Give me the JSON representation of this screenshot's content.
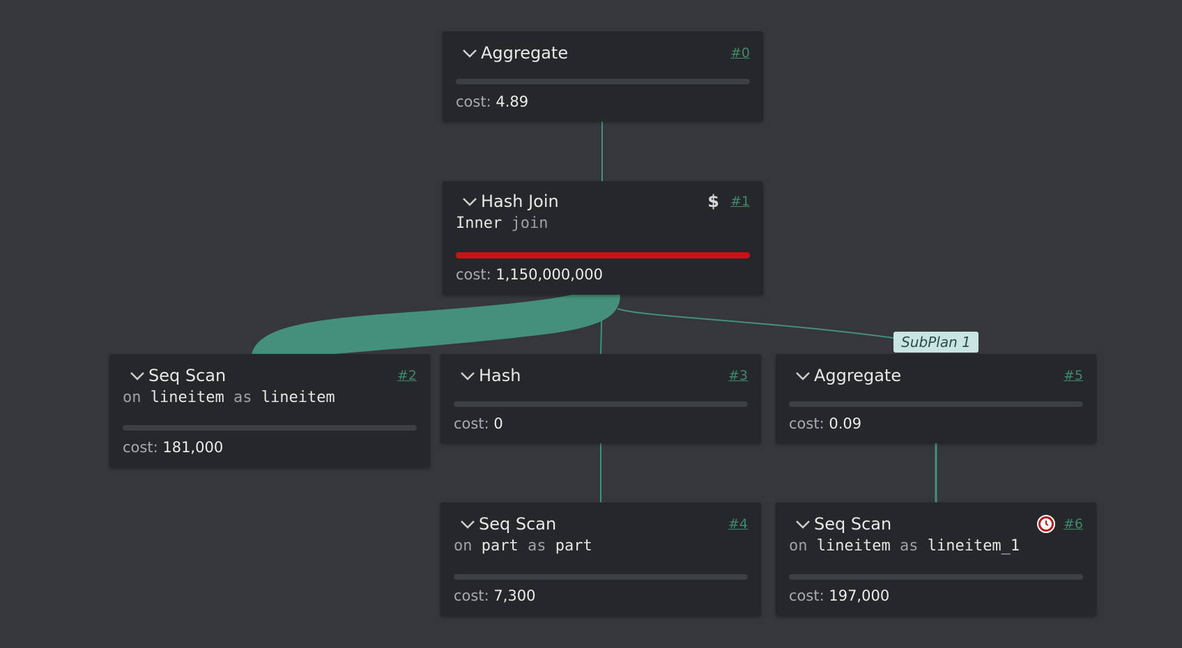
{
  "colors": {
    "edge": "#44907a",
    "cost_bar_high": "#c41414",
    "link": "#3f8a6d"
  },
  "nodes": [
    {
      "id": "#0",
      "title": "Aggregate",
      "cost_label": "cost:",
      "cost_value": "4.89",
      "cost_fraction": 0.0
    },
    {
      "id": "#1",
      "title": "Hash Join",
      "sub_main": "Inner",
      "sub_kw": "join",
      "badge_icon": "dollar-icon",
      "badge_text": "$",
      "cost_label": "cost:",
      "cost_value": "1,150,000,000",
      "cost_fraction": 1.0
    },
    {
      "id": "#2",
      "title": "Seq Scan",
      "sub_on": "on",
      "sub_table": "lineitem",
      "sub_as": "as",
      "sub_alias": "lineitem",
      "cost_label": "cost:",
      "cost_value": "181,000",
      "cost_fraction": 0.0
    },
    {
      "id": "#3",
      "title": "Hash",
      "cost_label": "cost:",
      "cost_value": "0",
      "cost_fraction": 0.0
    },
    {
      "id": "#5",
      "title": "Aggregate",
      "cost_label": "cost:",
      "cost_value": "0.09",
      "cost_fraction": 0.0
    },
    {
      "id": "#4",
      "title": "Seq Scan",
      "sub_on": "on",
      "sub_table": "part",
      "sub_as": "as",
      "sub_alias": "part",
      "cost_label": "cost:",
      "cost_value": "7,300",
      "cost_fraction": 0.0
    },
    {
      "id": "#6",
      "title": "Seq Scan",
      "sub_on": "on",
      "sub_table": "lineitem",
      "sub_as": "as",
      "sub_alias": "lineitem_1",
      "badge_icon": "clock-icon",
      "cost_label": "cost:",
      "cost_value": "197,000",
      "cost_fraction": 0.0
    }
  ],
  "subplan_label": "SubPlan 1"
}
